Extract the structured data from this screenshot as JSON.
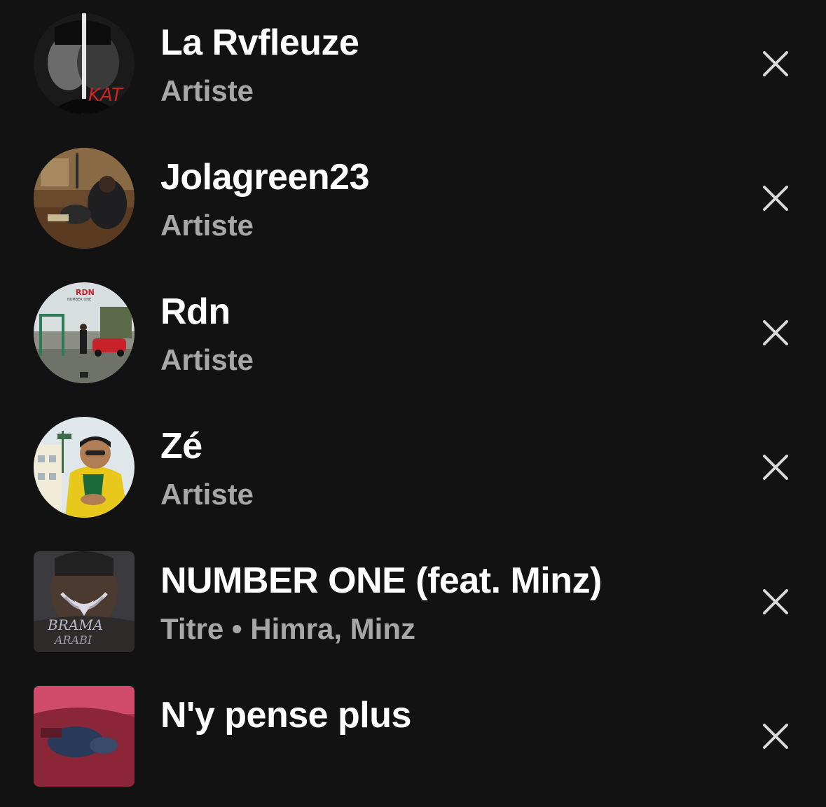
{
  "recent_searches": [
    {
      "title": "La Rvfleuze",
      "subtitle": "Artiste",
      "kind": "artist",
      "art": "portrait-bw"
    },
    {
      "title": "Jolagreen23",
      "subtitle": "Artiste",
      "kind": "artist",
      "art": "studio"
    },
    {
      "title": "Rdn",
      "subtitle": "Artiste",
      "kind": "artist",
      "art": "number-one-cover"
    },
    {
      "title": "Zé",
      "subtitle": "Artiste",
      "kind": "artist",
      "art": "yellow-shirt"
    },
    {
      "title": "NUMBER ONE (feat. Minz)",
      "subtitle": "Titre • Himra, Minz",
      "kind": "track",
      "art": "chain-cover"
    },
    {
      "title": "N'y pense plus",
      "subtitle": "",
      "kind": "track",
      "art": "red-cover"
    }
  ],
  "icons": {
    "remove": "close-icon"
  },
  "colors": {
    "background": "#121212",
    "title": "#ffffff",
    "subtitle": "#a7a7a7",
    "icon": "#d9d9d9"
  }
}
